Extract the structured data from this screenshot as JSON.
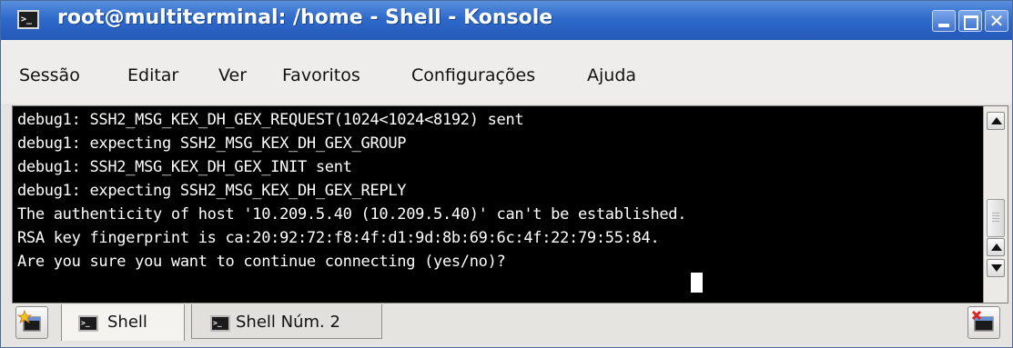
{
  "window": {
    "title": "root@multiterminal: /home - Shell - Konsole",
    "app_icon_glyph": ">_",
    "close_glyph": "✕"
  },
  "menu": [
    "Sessão",
    "Editar",
    "Ver",
    "Favoritos",
    "Configurações",
    "Ajuda"
  ],
  "terminal": {
    "lines": [
      "debug1: SSH2_MSG_KEX_DH_GEX_REQUEST(1024<1024<8192) sent",
      "debug1: expecting SSH2_MSG_KEX_DH_GEX_GROUP",
      "debug1: SSH2_MSG_KEX_DH_GEX_INIT sent",
      "debug1: expecting SSH2_MSG_KEX_DH_GEX_REPLY",
      "The authenticity of host '10.209.5.40 (10.209.5.40)' can't be established.",
      "RSA key fingerprint is ca:20:92:72:f8:4f:d1:9d:8b:69:6c:4f:22:79:55:84.",
      "Are you sure you want to continue connecting (yes/no)? "
    ],
    "colors": {
      "background": "#000000",
      "foreground": "#ffffff"
    }
  },
  "tabs": [
    {
      "label": "Shell",
      "active": true
    },
    {
      "label": "Shell Núm. 2",
      "active": false
    }
  ],
  "icons": {
    "new_tab": "new-session-icon",
    "close_tab": "close-session-icon",
    "tab": "konsole-icon"
  },
  "colors": {
    "titlebar": "#2e6acb",
    "menubar": "#eeedeb"
  }
}
